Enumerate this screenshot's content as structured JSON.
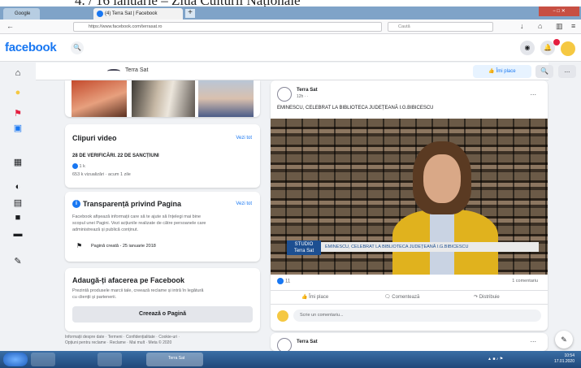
{
  "caption": "4.  / 16 ianuarie – Ziua Culturii Naționale",
  "browser": {
    "tab1": "Google",
    "tab2": "(4) Terra Sat | Facebook",
    "url": "https://www.facebook.com/terrasat.ro",
    "search_placeholder": "Caută"
  },
  "header": {
    "logo": "facebook"
  },
  "page_header": {
    "name": "Terra Sat",
    "like_button": "Îmi place",
    "search_icon": "search-icon",
    "more": "..."
  },
  "videos_card": {
    "title": "Clipuri video",
    "see_all": "Vezi tot",
    "video_title": "28 DE VERIFICĂRI. 22 DE SANCȚIUNI",
    "video_reactions": "1 k",
    "video_meta": "653 k vizualizări · acum 1 zile"
  },
  "transparency_card": {
    "title": "Transparență privind Pagina",
    "see_all": "Vezi tot",
    "desc": [
      "Facebook afișează informații care să te ajute să înțelegi mai bine",
      "scopul unei Pagini. Vezi acțiunile realizate de către persoanele care",
      "administrează și publică conținut."
    ],
    "created": "Pagină creată - 25 ianuarie 2018"
  },
  "business_card": {
    "title": "Adaugă-ți afacerea pe Facebook",
    "desc": [
      "Prezintă produsele marcii tale, creează reclame și intră în legătură",
      "cu clienții și partenerii."
    ],
    "button": "Creează o Pagină"
  },
  "footer": [
    "Informații despre date · Termeni · Confidențialitate · Cookie-uri ·",
    "Opțiuni pentru reclame · Reclame · Mai mult · Meta © 2020"
  ],
  "post": {
    "author": "Terra Sat",
    "time": "12h · ·",
    "more": "...",
    "text": "EMINESCU, CELEBRAT LA BIBLIOTECA JUDEȚEANĂ I.G.BIBICESCU",
    "video_logo_top": "STUDIO",
    "video_logo_bottom": "Terra Sat",
    "video_caption": "EMINESCU, CELEBRAT LA BIBLIOTECA JUDEȚEANĂ I.G.BIBICESCU",
    "reactions": "11",
    "comments": "1 comentariu",
    "like": "Îmi place",
    "comment": "Comentează",
    "share": "Distribuie",
    "comment_placeholder": "Scrie un comentariu..."
  },
  "post2": {
    "author": "Terra Sat",
    "more": "..."
  },
  "taskbar": {
    "label": "Terra Sat",
    "time": "10:54",
    "date": "17.01.2020"
  }
}
